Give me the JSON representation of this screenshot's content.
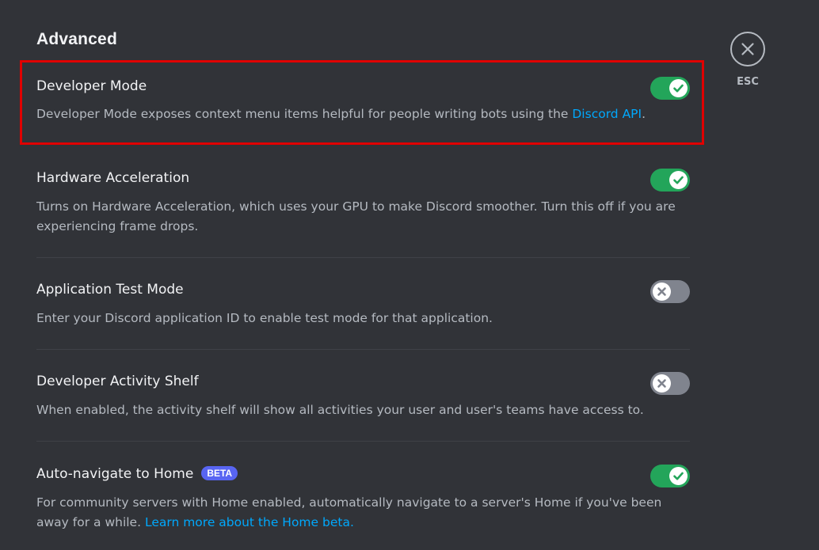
{
  "section": {
    "title": "Advanced"
  },
  "settings": [
    {
      "title": "Developer Mode",
      "description": "Developer Mode exposes context menu items helpful for people writing bots using the ",
      "link": "Discord API",
      "description_after": ".",
      "toggle_state": "on",
      "highlighted": true
    },
    {
      "title": "Hardware Acceleration",
      "description": "Turns on Hardware Acceleration, which uses your GPU to make Discord smoother. Turn this off if you are experiencing frame drops.",
      "toggle_state": "on"
    },
    {
      "title": "Application Test Mode",
      "description": "Enter your Discord application ID to enable test mode for that application.",
      "toggle_state": "off"
    },
    {
      "title": "Developer Activity Shelf",
      "description": "When enabled, the activity shelf will show all activities your user and user's teams have access to.",
      "toggle_state": "off"
    },
    {
      "title": "Auto-navigate to Home",
      "badge": "BETA",
      "description": "For community servers with Home enabled, automatically navigate to a server's Home if you've been away for a while. ",
      "link": "Learn more about the Home beta.",
      "toggle_state": "on"
    }
  ],
  "close": {
    "label": "ESC",
    "icon": "close-icon"
  },
  "colors": {
    "background": "#313338",
    "toggle_on": "#23a55a",
    "toggle_off": "#80848e",
    "link": "#00a8fc",
    "badge": "#5865f2",
    "highlight": "#e00000"
  }
}
